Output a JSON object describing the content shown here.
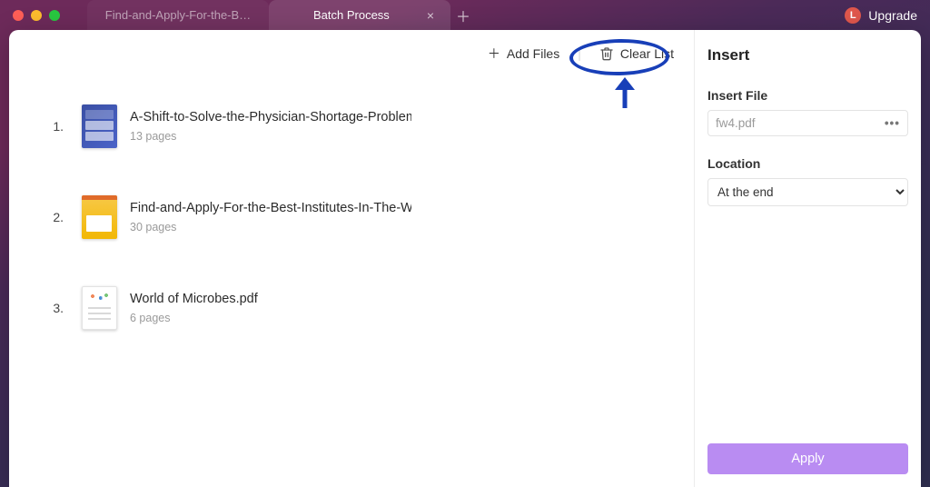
{
  "titlebar": {
    "tabs": [
      {
        "title": "Find-and-Apply-For-the-B…",
        "active": false
      },
      {
        "title": "Batch Process",
        "active": true
      }
    ],
    "avatar_letter": "L",
    "upgrade_label": "Upgrade"
  },
  "toolbar": {
    "add_files_label": "Add Files",
    "clear_list_label": "Clear List"
  },
  "files": [
    {
      "num": "1.",
      "name": "A-Shift-to-Solve-the-Physician-Shortage-Problem-ar",
      "pages": "13 pages",
      "thumb": "c1"
    },
    {
      "num": "2.",
      "name": "Find-and-Apply-For-the-Best-Institutes-In-The-World",
      "pages": "30 pages",
      "thumb": "c2"
    },
    {
      "num": "3.",
      "name": "World of Microbes.pdf",
      "pages": "6 pages",
      "thumb": "c3"
    }
  ],
  "panel": {
    "title": "Insert",
    "insert_file_label": "Insert File",
    "insert_file_value": "fw4.pdf",
    "location_label": "Location",
    "location_value": "At the end",
    "apply_label": "Apply"
  }
}
